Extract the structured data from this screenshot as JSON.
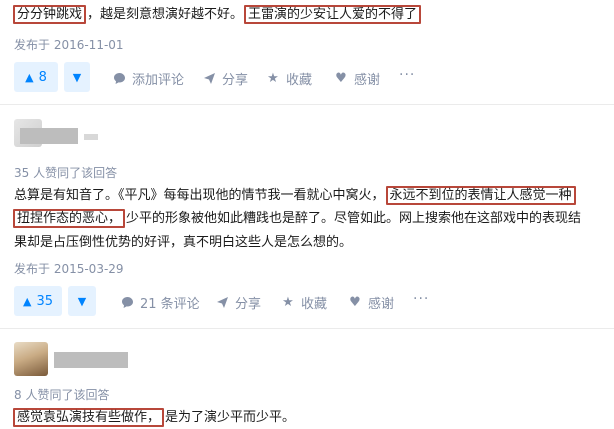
{
  "answer1": {
    "line1_hl_a": "分分钟跳戏",
    "line1_mid": "，越是刻意想演好越不好。",
    "line1_hl_b": "王雷演的少安让人爱的不得了",
    "published": "发布于 2016-11-01",
    "vote_count": "8",
    "actions": {
      "comment": "添加评论",
      "share": "分享",
      "favorite": "收藏",
      "thanks": "感谢"
    }
  },
  "answer2": {
    "agree_text": "35 人赞同了该回答",
    "line1_pre": "总算是有知音了。《平凡》每每出现他的情节我一看就心中窝火，",
    "line1_hl": "永远不到位的表情让人感觉一种",
    "line2_hl": "扭捏作态的恶心，",
    "line2_post": "少平的形象被他如此糟践也是醉了。尽管如此。网上搜索他在这部戏中的表现结",
    "line3": "果却是占压倒性优势的好评，真不明白这些人是怎么想的。",
    "published": "发布于 2015-03-29",
    "vote_count": "35",
    "actions": {
      "comment": "21 条评论",
      "share": "分享",
      "favorite": "收藏",
      "thanks": "感谢"
    }
  },
  "answer3": {
    "agree_text": "8 人赞同了该回答",
    "line1_hl": "感觉袁弘演技有些做作，",
    "line1_post": "是为了演少平而少平。"
  },
  "colors": {
    "accent": "#0084ff",
    "highlight_border": "#b8473a",
    "meta": "#8590a6"
  },
  "icons": [
    "upvote-arrow-icon",
    "downvote-arrow-icon",
    "comment-bubble-icon",
    "share-plane-icon",
    "star-icon",
    "heart-icon",
    "more-dots-icon"
  ]
}
